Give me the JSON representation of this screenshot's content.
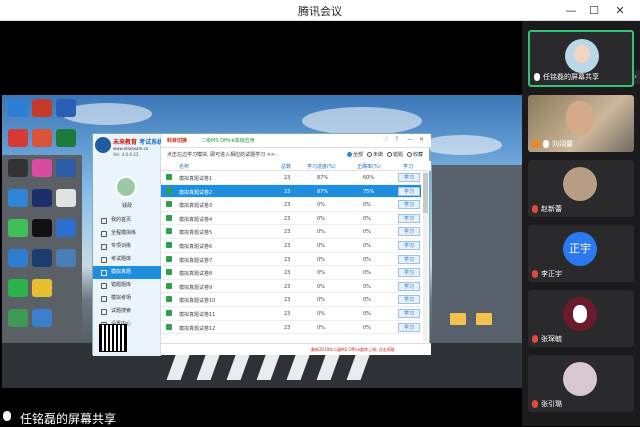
{
  "window": {
    "title": "腾讯会议"
  },
  "share_banner": {
    "text": "任铭磊的屏幕共享"
  },
  "participants": [
    {
      "name": "任铭磊的屏幕共享",
      "type": "screen-share",
      "active": true
    },
    {
      "name": "刘翊馨",
      "type": "video",
      "host": true
    },
    {
      "name": "赵新蕾",
      "type": "avatar"
    },
    {
      "name": "李正宇",
      "type": "initials",
      "initials": "正宇"
    },
    {
      "name": "张琛毓",
      "type": "avatar"
    },
    {
      "name": "张引璐",
      "type": "avatar"
    }
  ],
  "app": {
    "brand": {
      "name": "未来教育",
      "sub": "考试系统",
      "url": "www.eduexam.cn",
      "version": "Ver. 4.0.6.33"
    },
    "username": "钱政",
    "top_tabs": [
      "科目切换",
      "二级MS Office高级应用"
    ],
    "nav": [
      "我的首页",
      "全程模拟练",
      "专项训练",
      "考试题库",
      "模拟真题",
      "错题题库",
      "模拟考场",
      "试题搜索",
      "设置中心"
    ],
    "active_nav_index": 4,
    "hint": "点击左边学习模块, 即可进入相应的试题学习 >>",
    "filters": [
      {
        "label": "全部",
        "on": true
      },
      {
        "label": "未做",
        "on": false
      },
      {
        "label": "错题",
        "on": false
      },
      {
        "label": "收藏",
        "on": false
      }
    ],
    "columns": [
      "名称",
      "总数",
      "学习进度(%)",
      "正确率(%)",
      "学习"
    ],
    "rows": [
      {
        "name": "模拟真题试卷1",
        "total": "23",
        "progress": "87%",
        "accuracy": "60%",
        "action": "学习",
        "selected": false
      },
      {
        "name": "模拟真题试卷2",
        "total": "23",
        "progress": "87%",
        "accuracy": "75%",
        "action": "学习",
        "selected": true
      },
      {
        "name": "模拟真题试卷3",
        "total": "23",
        "progress": "0%",
        "accuracy": "0%",
        "action": "学习",
        "selected": false
      },
      {
        "name": "模拟真题试卷4",
        "total": "23",
        "progress": "0%",
        "accuracy": "0%",
        "action": "学习",
        "selected": false
      },
      {
        "name": "模拟真题试卷5",
        "total": "23",
        "progress": "0%",
        "accuracy": "0%",
        "action": "学习",
        "selected": false
      },
      {
        "name": "模拟真题试卷6",
        "total": "23",
        "progress": "0%",
        "accuracy": "0%",
        "action": "学习",
        "selected": false
      },
      {
        "name": "模拟真题试卷7",
        "total": "23",
        "progress": "0%",
        "accuracy": "0%",
        "action": "学习",
        "selected": false
      },
      {
        "name": "模拟真题试卷8",
        "total": "23",
        "progress": "0%",
        "accuracy": "0%",
        "action": "学习",
        "selected": false
      },
      {
        "name": "模拟真题试卷9",
        "total": "23",
        "progress": "0%",
        "accuracy": "0%",
        "action": "学习",
        "selected": false
      },
      {
        "name": "模拟真题试卷10",
        "total": "23",
        "progress": "0%",
        "accuracy": "0%",
        "action": "学习",
        "selected": false
      },
      {
        "name": "模拟真题试卷11",
        "total": "23",
        "progress": "0%",
        "accuracy": "0%",
        "action": "学习",
        "selected": false
      },
      {
        "name": "模拟真题试卷12",
        "total": "23",
        "progress": "0%",
        "accuracy": "0%",
        "action": "学习",
        "selected": false
      }
    ],
    "footer_notice": "最新2019年二级MS Office题库上线, 点击领取"
  },
  "colors": {
    "accent": "#1e8fe0",
    "active_tile": "#33c27a",
    "panel_bg": "#1b1b1d"
  }
}
